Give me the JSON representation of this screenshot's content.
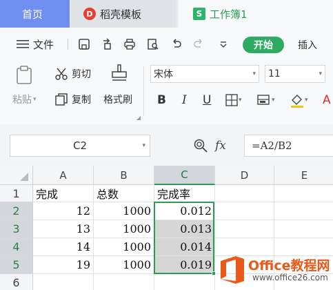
{
  "tabs": {
    "home": "首页",
    "store": "稻壳模板",
    "workbook": "工作簿1"
  },
  "menu": {
    "file": "文件",
    "start": "开始",
    "insert": "插入"
  },
  "ribbon": {
    "paste": "粘贴",
    "cut": "剪切",
    "copy": "复制",
    "format_painter": "格式刷",
    "font_name": "宋体",
    "font_size": "11",
    "bold": "B",
    "italic": "I",
    "underline": "U"
  },
  "formula_bar": {
    "name_box": "C2",
    "fx": "fx",
    "formula": "=A2/B2"
  },
  "sheet": {
    "columns": [
      "A",
      "B",
      "C",
      "D",
      "E"
    ],
    "rows": [
      "1",
      "2",
      "3",
      "4",
      "5",
      "6"
    ],
    "header": [
      "完成",
      "总数",
      "完成率"
    ],
    "data": [
      [
        "12",
        "1000",
        "0.012"
      ],
      [
        "13",
        "1000",
        "0.013"
      ],
      [
        "14",
        "1000",
        "0.014"
      ],
      [
        "19",
        "1000",
        "0.019"
      ]
    ],
    "selected_column": "C"
  },
  "watermark": {
    "brand": "Office教程网",
    "url": "www.office26.com"
  },
  "colors": {
    "accent_green": "#2eab63",
    "home_tab_blue": "#6f8ff0",
    "watermark_orange": "#e8591a"
  }
}
